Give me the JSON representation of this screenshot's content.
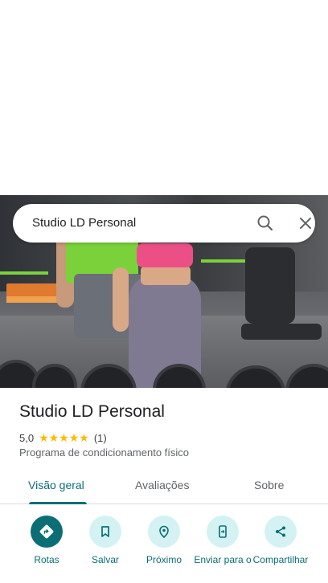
{
  "search": {
    "value": "Studio LD Personal"
  },
  "place": {
    "title": "Studio LD Personal",
    "rating_value": "5,0",
    "stars": "★★★★★",
    "review_count": "(1)",
    "category": "Programa de condicionamento físico"
  },
  "tabs": [
    {
      "label": "Visão geral",
      "active": true
    },
    {
      "label": "Avaliações",
      "active": false
    },
    {
      "label": "Sobre",
      "active": false
    }
  ],
  "actions": [
    {
      "label": "Rotas",
      "icon": "directions-icon"
    },
    {
      "label": "Salvar",
      "icon": "bookmark-icon"
    },
    {
      "label": "Próximo",
      "icon": "nearby-icon"
    },
    {
      "label": "Enviar para o",
      "icon": "send-to-phone-icon"
    },
    {
      "label": "Compartilhar",
      "icon": "share-icon"
    }
  ],
  "colors": {
    "accent": "#0b6e75",
    "action_bg": "#d4f2f3",
    "star": "#fbbc04"
  }
}
